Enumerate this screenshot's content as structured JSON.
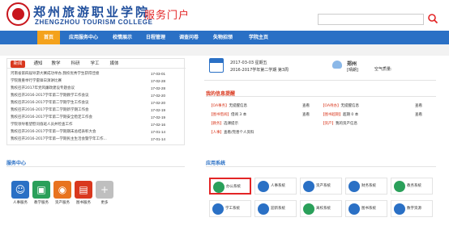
{
  "header": {
    "logo_cn": "郑州旅游职业学院",
    "logo_en": "ZHENGZHOU TOURISM COLLEGE",
    "portal_title": "服务门户",
    "search_placeholder": ""
  },
  "nav": [
    "首页",
    "应用服务中心",
    "校情展示",
    "日程管理",
    "调查问卷",
    "失物招领",
    "学院主页"
  ],
  "news": {
    "tabs": [
      "新闻",
      "通知",
      "教学",
      "科研",
      "学工",
      "媒体"
    ],
    "items": [
      {
        "title": "河南省第四届导游大赛成功举办,我校优秀学生获得佳绩",
        "date": "17-03-01"
      },
      {
        "title": "学院隆重举行学雷锋日演讲比赛",
        "date": "17-02-28"
      },
      {
        "title": "我校召开2017年党风廉政建设专题会议",
        "date": "17-02-28"
      },
      {
        "title": "我校召开2016-2017学年第二学期教学工作会议",
        "date": "17-02-20"
      },
      {
        "title": "我校召开2016-2017学年第二学期学生工作会议",
        "date": "17-02-20"
      },
      {
        "title": "我校召开2016-2017学年第二学期新学期工作会",
        "date": "17-02-19"
      },
      {
        "title": "我校召开2016-2017学年第二学期安全稳定工作会",
        "date": "17-02-19"
      },
      {
        "title": "学院领导看望慰问值班人员并检查工作",
        "date": "17-02-16"
      },
      {
        "title": "我校召开2016-2017学年第一学期期末总结表彰大会",
        "date": "17-01-14"
      },
      {
        "title": "我校召开2016-2017学年第一学期民主生活会暨学年工作...",
        "date": "17-01-14"
      }
    ]
  },
  "service_center": {
    "title": "服务中心",
    "items": [
      {
        "label": "人事服务",
        "color": "#2a70c5",
        "icon": "person-icon"
      },
      {
        "label": "教学服务",
        "color": "#2aa05a",
        "icon": "teach-icon"
      },
      {
        "label": "资产服务",
        "color": "#e8731e",
        "icon": "asset-icon"
      },
      {
        "label": "图书服务",
        "color": "#d9381e",
        "icon": "book-icon"
      },
      {
        "label": "更多",
        "color": "#bfbfbf",
        "icon": "plus-icon"
      }
    ]
  },
  "calendar": {
    "date_line": "2017-03-03 星期五",
    "term_line": "2016-2017学年第二学期   第3周",
    "city": "郑州",
    "weather": "[晴朗]",
    "air": "空气质量:"
  },
  "messages": {
    "title": "我的信息提醒",
    "view_label": "查看",
    "left": [
      {
        "tag": "【OA事务】",
        "text": "无提醒信息"
      },
      {
        "tag": "【图书借阅】",
        "text": "借阅 3 本"
      },
      {
        "tag": "【教务】",
        "text": "选课提示"
      },
      {
        "tag": "【人事】",
        "text": "查看/完善个人资料"
      }
    ],
    "right": [
      {
        "tag": "【OA待办】",
        "text": "无提醒信息"
      },
      {
        "tag": "【图书超期】",
        "text": "超期 0 本"
      },
      {
        "tag": "【资产】",
        "text": "我的资产信息"
      }
    ]
  },
  "apps": {
    "title": "应用系统",
    "items": [
      {
        "label": "办公系统",
        "color": "#2aa05a"
      },
      {
        "label": "人事系统",
        "color": "#2a70c5"
      },
      {
        "label": "资产系统",
        "color": "#2a70c5"
      },
      {
        "label": "财务系统",
        "color": "#2a70c5"
      },
      {
        "label": "教务系统",
        "color": "#2aa05a"
      },
      {
        "label": "学工系统",
        "color": "#2a70c5"
      },
      {
        "label": "迎新系统",
        "color": "#2a70c5"
      },
      {
        "label": "离校系统",
        "color": "#2aa05a"
      },
      {
        "label": "图书系统",
        "color": "#2a70c5"
      },
      {
        "label": "数字资源",
        "color": "#2a70c5"
      }
    ]
  }
}
